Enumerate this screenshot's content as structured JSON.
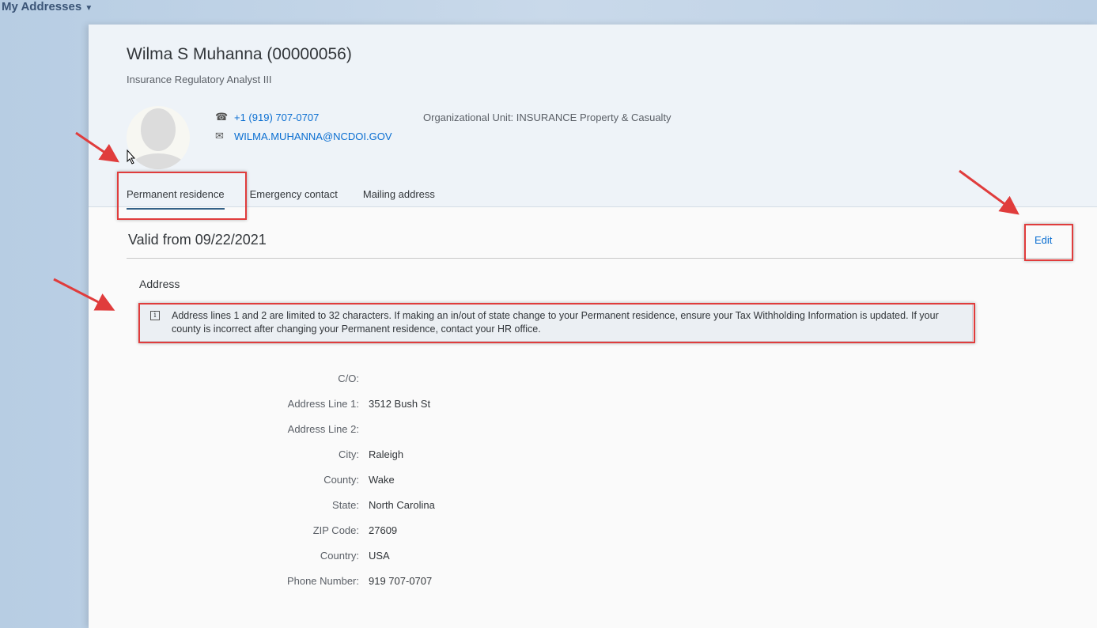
{
  "app": {
    "title": "My Addresses"
  },
  "employee": {
    "name": "Wilma S Muhanna (00000056)",
    "job_title": "Insurance Regulatory Analyst III",
    "phone": "+1 (919) 707-0707",
    "email": "WILMA.MUHANNA@NCDOI.GOV",
    "org_unit": "Organizational Unit: INSURANCE Property & Casualty"
  },
  "tabs": [
    {
      "label": "Permanent residence"
    },
    {
      "label": "Emergency contact"
    },
    {
      "label": "Mailing address"
    }
  ],
  "section": {
    "valid_from": "Valid from 09/22/2021",
    "edit_label": "Edit",
    "address_heading": "Address",
    "info_text": "Address lines 1 and 2 are limited to 32 characters. If making an in/out of state change to your Permanent residence, ensure your Tax Withholding Information is updated. If your county is incorrect after changing your Permanent residence, contact your HR office."
  },
  "fields": [
    {
      "label": "C/O:",
      "value": ""
    },
    {
      "label": "Address Line 1:",
      "value": "3512 Bush St"
    },
    {
      "label": "Address Line 2:",
      "value": ""
    },
    {
      "label": "City:",
      "value": "Raleigh"
    },
    {
      "label": "County:",
      "value": "Wake"
    },
    {
      "label": "State:",
      "value": "North Carolina"
    },
    {
      "label": "ZIP Code:",
      "value": "27609"
    },
    {
      "label": "Country:",
      "value": "USA"
    },
    {
      "label": "Phone Number:",
      "value": "919 707-0707"
    }
  ],
  "colors": {
    "accent": "#0a6ed1",
    "annotation": "#e03c3c"
  }
}
